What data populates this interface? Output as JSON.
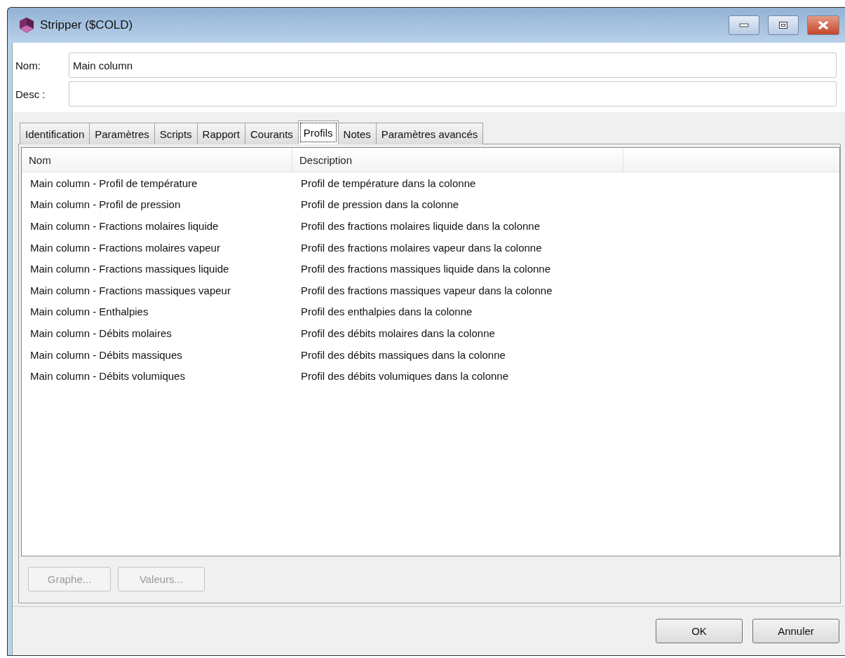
{
  "window": {
    "title": "Stripper ($COLD)"
  },
  "fields": [
    {
      "label": "Nom:",
      "value": "Main column"
    },
    {
      "label": "Desc :"
    }
  ],
  "tabs": [
    {
      "label": "Identification",
      "selected": false
    },
    {
      "label": "Paramètres",
      "selected": false
    },
    {
      "label": "Scripts",
      "selected": false
    },
    {
      "label": "Rapport",
      "selected": false
    },
    {
      "label": "Courants",
      "selected": false
    },
    {
      "label": "Profils",
      "selected": true
    },
    {
      "label": "Notes",
      "selected": false
    },
    {
      "label": "Paramètres avancés",
      "selected": false
    }
  ],
  "table": {
    "columns": [
      "Nom",
      "Description"
    ],
    "rows": [
      [
        "Main column - Profil de température",
        "Profil de température dans la colonne"
      ],
      [
        "Main column - Profil de pression",
        "Profil de pression dans la colonne"
      ],
      [
        "Main column - Fractions molaires liquide",
        "Profil des fractions molaires liquide dans la colonne"
      ],
      [
        "Main column - Fractions molaires vapeur",
        "Profil des fractions molaires vapeur dans la colonne"
      ],
      [
        "Main column - Fractions massiques liquide",
        "Profil des fractions massiques liquide dans la colonne"
      ],
      [
        "Main column - Fractions massiques vapeur",
        "Profil des fractions massiques vapeur dans la colonne"
      ],
      [
        "Main column - Enthalpies",
        "Profil des enthalpies dans la colonne"
      ],
      [
        "Main column - Débits molaires",
        "Profil des débits molaires dans la colonne"
      ],
      [
        "Main column - Débits massiques",
        "Profil des débits massiques dans la colonne"
      ],
      [
        "Main column - Débits volumiques",
        "Profil des débits volumiques dans la colonne"
      ]
    ]
  },
  "panel_buttons": [
    {
      "label": "Graphe...",
      "disabled": true
    },
    {
      "label": "Valeurs...",
      "disabled": true
    }
  ],
  "dialog_buttons": [
    {
      "label": "OK"
    },
    {
      "label": "Annuler"
    }
  ]
}
